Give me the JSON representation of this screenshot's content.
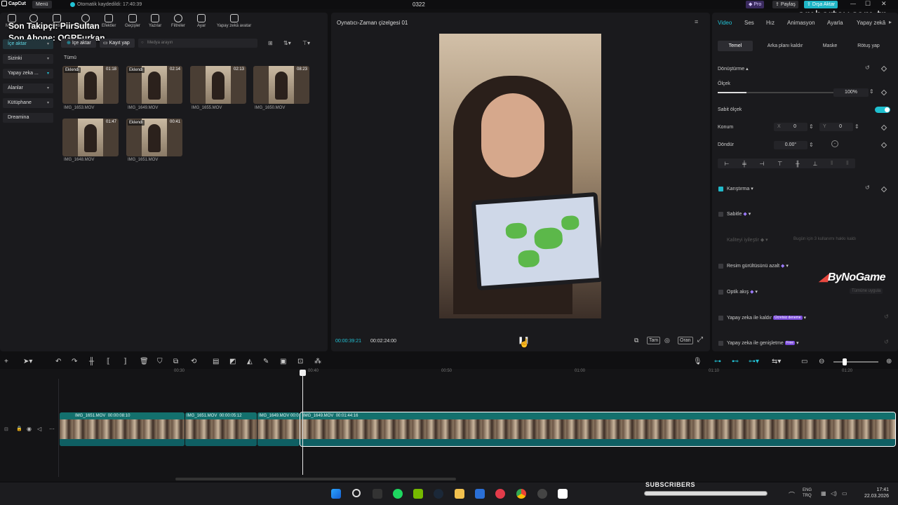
{
  "titlebar": {
    "app_name": "CapCut",
    "menu": "Menü",
    "autosave": "Otomatik kaydedildi: 17:40:39",
    "project": "0322",
    "pro": "Pro",
    "share": "Paylaş",
    "export": "Dışa Aktar"
  },
  "watermark": {
    "site": "ambertey.com.tr",
    "brand": "ByNoGame"
  },
  "overlay": {
    "follower": "Son Takipçi: PiirSultan",
    "subscriber": "Son Abone: OGRFurkan"
  },
  "toolbar": {
    "tools": [
      "Medya",
      "Ses",
      "Metin",
      "Çıkartmalar",
      "Efektler",
      "Geçişler",
      "Yazılar",
      "Filtreler",
      "Ayar",
      "Yapay zekâ avatar"
    ]
  },
  "sidebar": {
    "items": [
      {
        "label": "İçe aktar"
      },
      {
        "label": "Sizinki"
      },
      {
        "label": "Yapay zeka ..."
      },
      {
        "label": "Alanlar"
      },
      {
        "label": "Kütüphane"
      },
      {
        "label": "Dreamina"
      }
    ]
  },
  "media": {
    "import_label": "İçe aktar",
    "record_label": "Kayıt yap",
    "search_placeholder": "Medya arayın",
    "all_label": "Tümü",
    "clips": [
      {
        "name": "IMG_1653.MOV",
        "duration": "01:18",
        "tag": "Eklendi"
      },
      {
        "name": "IMG_1649.MOV",
        "duration": "02:14",
        "tag": "Eklendi"
      },
      {
        "name": "IMG_1655.MOV",
        "duration": "02:13",
        "tag": ""
      },
      {
        "name": "IMG_1650.MOV",
        "duration": "08:23",
        "tag": ""
      },
      {
        "name": "IMG_1648.MOV",
        "duration": "01:47",
        "tag": ""
      },
      {
        "name": "IMG_1651.MOV",
        "duration": "00:41",
        "tag": "Eklendi"
      }
    ]
  },
  "player": {
    "title": "Oynatıcı-Zaman çizelgesi 01",
    "current_time": "00:00:39:21",
    "total_time": "00:02:24:00",
    "full_label": "Tam",
    "ratio_label": "Oran"
  },
  "inspector": {
    "tabs": [
      "Video",
      "Ses",
      "Hız",
      "Animasyon",
      "Ayarla",
      "Yapay zekâ"
    ],
    "subtabs": [
      "Temel",
      "Arka planı kaldır",
      "Maske",
      "Rötuş yap"
    ],
    "transform": "Dönüştürme",
    "scale_label": "Ölçek",
    "scale_value": "100%",
    "scale_fraction": 0.25,
    "uniform_scale": "Sabit ölçek",
    "position_label": "Konum",
    "pos_x_label": "X",
    "pos_x": "0",
    "pos_y_label": "Y",
    "pos_y": "0",
    "rotate_label": "Döndür",
    "rotate_value": "0.00°",
    "blend": "Karıştırma",
    "stabilize": "Sabitle",
    "enhance": "Kaliteyi iyileştir",
    "enhance_note": "Bugün için 3 kullanımı hakkı kaldı",
    "denoise": "Resim gürültüsünü azalt",
    "optical_flow": "Optik akış",
    "optical_note": "Tümüne uygula",
    "ai_remove": "Yapay zeka ile kaldır",
    "ai_remove_badge": "Ücretsiz deneme",
    "ai_expand": "Yapay zeka ile genişletme",
    "ai_expand_badge": "Free"
  },
  "timeline": {
    "ruler": [
      "00:30",
      "00:40",
      "00:50",
      "01:00",
      "01:10",
      "01:20"
    ],
    "clips": [
      {
        "name": "IMG_1651.MOV",
        "duration": "00:00:08:10"
      },
      {
        "name": "IMG_1651.MOV",
        "duration": "00:00:05:12"
      },
      {
        "name": "IMG_1649.MOV",
        "duration": "00:0"
      },
      {
        "name": "IMG_1649.MOV",
        "duration": "00:01:44:16"
      }
    ]
  },
  "taskbar": {
    "subscribers": "SUBSCRIBERS",
    "lang1": "ENG",
    "lang2": "TRQ",
    "time": "17:41",
    "date": "22.03.2026"
  },
  "colors": {
    "accent": "#22c3d6",
    "export": "#1fb6c6",
    "clip": "#1a8a86"
  }
}
